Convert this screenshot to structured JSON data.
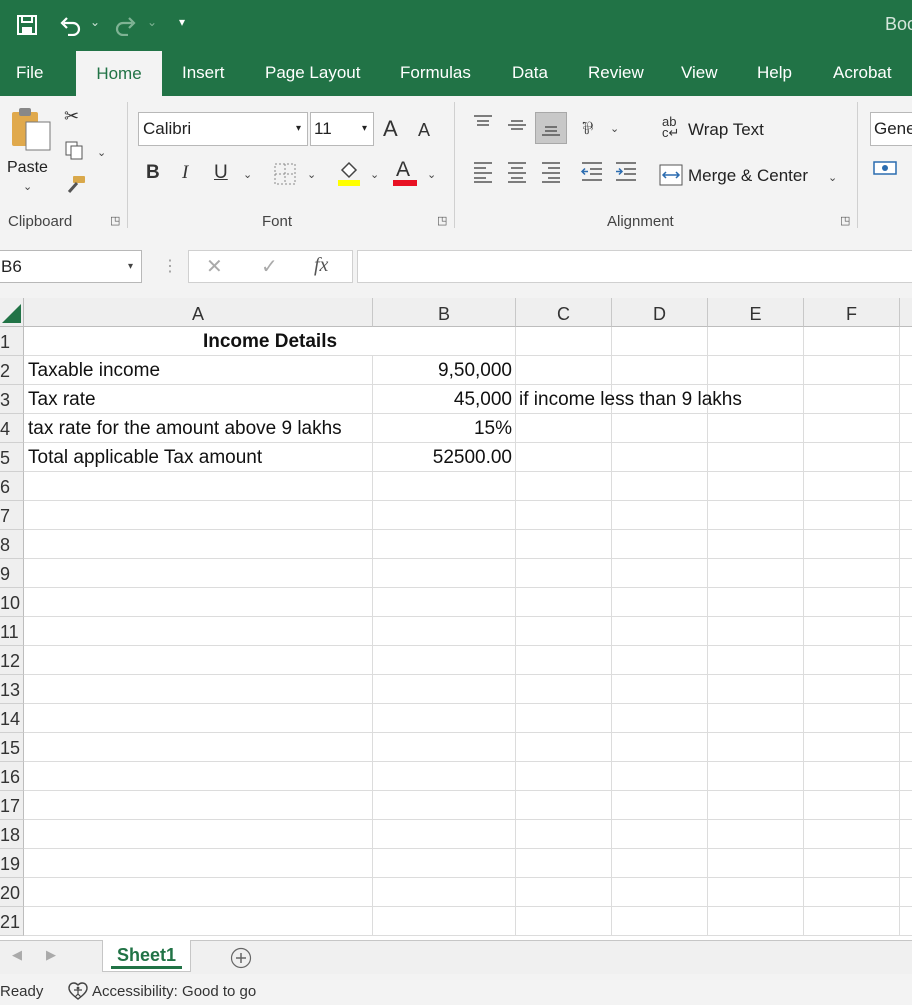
{
  "title_bar": {
    "app_title": "Boo",
    "undo_icon": "undo-icon",
    "redo_icon": "redo-icon",
    "save_icon": "save-icon",
    "qat_icon": "customize-quick-access-icon"
  },
  "tabs": [
    {
      "label": "File"
    },
    {
      "label": "Home"
    },
    {
      "label": "Insert"
    },
    {
      "label": "Page Layout"
    },
    {
      "label": "Formulas"
    },
    {
      "label": "Data"
    },
    {
      "label": "Review"
    },
    {
      "label": "View"
    },
    {
      "label": "Help"
    },
    {
      "label": "Acrobat"
    }
  ],
  "active_tab": "Home",
  "ribbon": {
    "clipboard": {
      "paste_label": "Paste",
      "group_label": "Clipboard"
    },
    "font": {
      "font_name": "Calibri",
      "font_size": "11",
      "bold": "B",
      "italic": "I",
      "underline": "U",
      "grow": "A",
      "shrink": "A",
      "font_color": "A",
      "group_label": "Font"
    },
    "alignment": {
      "wrap_text": "Wrap Text",
      "merge_center": "Merge & Center",
      "group_label": "Alignment"
    },
    "number": {
      "format": "Gene"
    }
  },
  "formula_bar": {
    "name_box": "B6",
    "cancel": "✕",
    "enter": "✓",
    "fx": "fx",
    "formula": ""
  },
  "columns": [
    "A",
    "B",
    "C",
    "D",
    "E",
    "F"
  ],
  "rows": [
    "1",
    "2",
    "3",
    "4",
    "5",
    "6",
    "7",
    "8",
    "9",
    "10",
    "11",
    "12",
    "13",
    "14",
    "15",
    "16",
    "17",
    "18",
    "19",
    "20",
    "21"
  ],
  "cells": {
    "A1": "Income Details",
    "A2": "Taxable income",
    "B2": "9,50,000",
    "A3": "Tax rate",
    "B3": "45,000",
    "C3": "if income less than 9 lakhs",
    "A4": "tax rate for the amount above 9 lakhs",
    "B4": "15%",
    "A5": "Total applicable Tax amount",
    "B5": "52500.00"
  },
  "sheets": [
    {
      "label": "Sheet1"
    }
  ],
  "status": {
    "ready": "Ready",
    "accessibility": "Accessibility: Good to go"
  },
  "colors": {
    "brand": "#217346",
    "ribbon_bg": "#f3f3f3",
    "font_color_bar": "#e81123",
    "highlight_bar": "#ffff00"
  }
}
